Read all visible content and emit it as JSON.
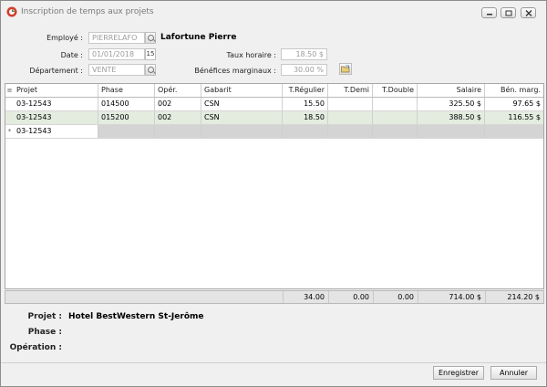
{
  "window": {
    "title": "Inscription de temps aux projets"
  },
  "form": {
    "employe_label": "Employé :",
    "employe_value": "PIERRELAFO",
    "employe_name": "Lafortune Pierre",
    "date_label": "Date :",
    "date_value": "01/01/2018",
    "cal_label": "15",
    "departement_label": "Département :",
    "departement_value": "VENTE",
    "taux_label": "Taux horaire :",
    "taux_value": "18.50 $",
    "benefices_label": "Bénéfices marginaux :",
    "benefices_value": "30.00 %"
  },
  "grid": {
    "columns": [
      "Projet",
      "Phase",
      "Opér.",
      "Gabarit",
      "T.Régulier",
      "T.Demi",
      "T.Double",
      "Salaire",
      "Bén. marg."
    ],
    "rows": [
      [
        "03-12543",
        "014500",
        "002",
        "CSN",
        "15.50",
        "",
        "",
        "325.50 $",
        "97.65 $"
      ],
      [
        "03-12543",
        "015200",
        "002",
        "CSN",
        "18.50",
        "",
        "",
        "388.50 $",
        "116.55 $"
      ]
    ],
    "new_row_project": "03-12543",
    "new_row_marker": "*",
    "header_marker": "≡",
    "totals": [
      "34.00",
      "0.00",
      "0.00",
      "714.00 $",
      "214.20 $"
    ]
  },
  "info": {
    "projet_label": "Projet :",
    "projet_value": "Hotel BestWestern  St-Jerôme",
    "phase_label": "Phase :",
    "phase_value": "",
    "operation_label": "Opération :",
    "operation_value": ""
  },
  "buttons": {
    "save": "Enregistrer",
    "cancel": "Annuler"
  }
}
